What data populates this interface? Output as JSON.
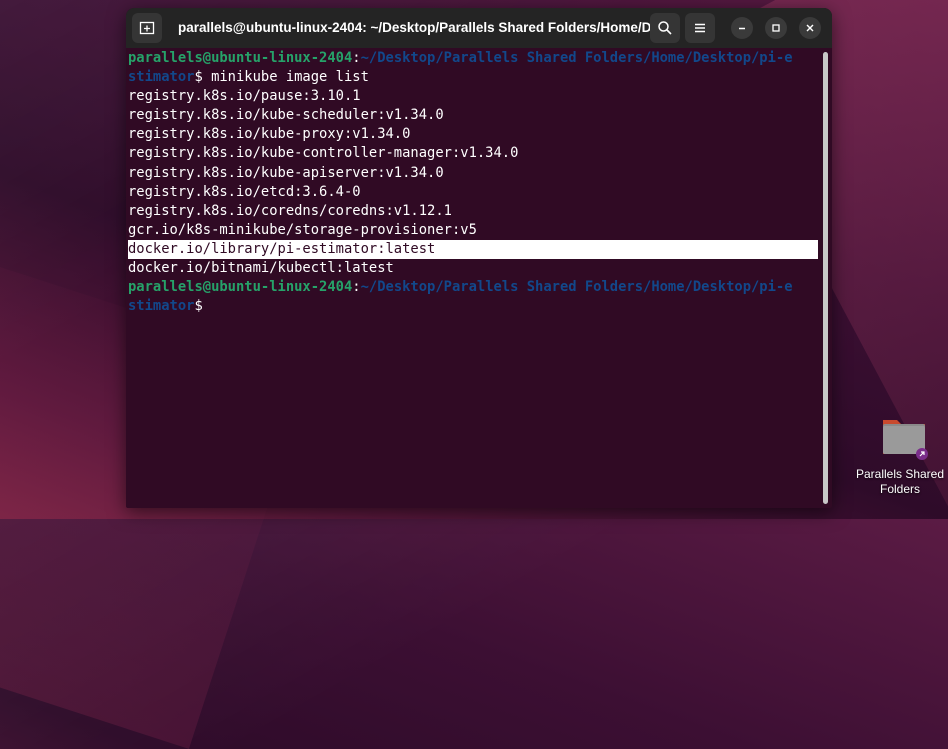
{
  "window": {
    "title": "parallels@ubuntu-linux-2404: ~/Desktop/Parallels Shared Folders/Home/D..."
  },
  "terminal": {
    "prompt_user": "parallels@ubuntu-linux-2404",
    "prompt_colon": ":",
    "prompt_path_1": "~/Desktop/Parallels Shared Folders/Home/Desktop/pi-e",
    "prompt_path_2": "stimator",
    "prompt_dollar_cmd": "$ minikube image list",
    "prompt_dollar": "$",
    "output": [
      "registry.k8s.io/pause:3.10.1",
      "registry.k8s.io/kube-scheduler:v1.34.0",
      "registry.k8s.io/kube-proxy:v1.34.0",
      "registry.k8s.io/kube-controller-manager:v1.34.0",
      "registry.k8s.io/kube-apiserver:v1.34.0",
      "registry.k8s.io/etcd:3.6.4-0",
      "registry.k8s.io/coredns/coredns:v1.12.1",
      "gcr.io/k8s-minikube/storage-provisioner:v5",
      "docker.io/library/pi-estimator:latest",
      "docker.io/bitnami/kubectl:latest"
    ],
    "highlighted_index": 8
  },
  "desktop": {
    "icon_label_1": "Parallels Shared",
    "icon_label_2": "Folders"
  },
  "colors": {
    "terminal_bg": "#300a24",
    "prompt_user": "#26a269",
    "prompt_path": "#12488b"
  }
}
